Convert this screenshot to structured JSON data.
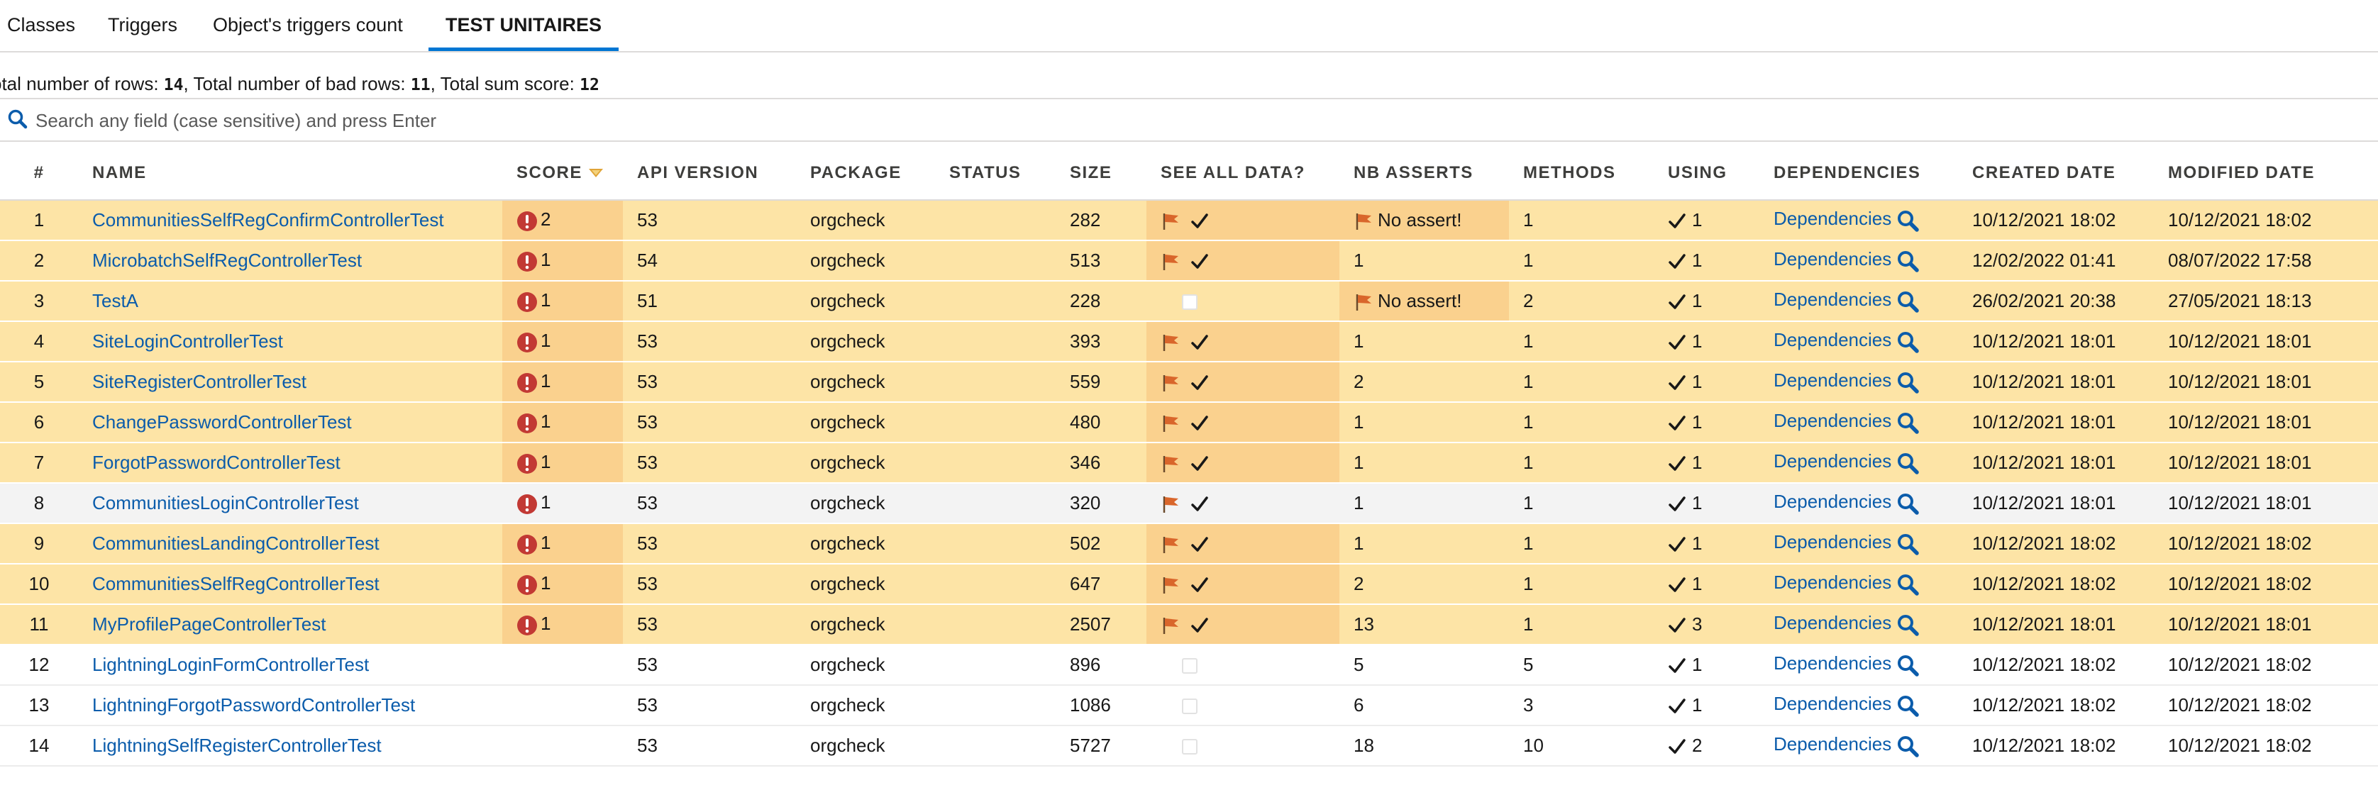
{
  "tabs": [
    {
      "label": "Classes",
      "active": false
    },
    {
      "label": "Triggers",
      "active": false
    },
    {
      "label": "Object's triggers count",
      "active": false
    },
    {
      "label": "TEST UNITAIRES",
      "active": true
    }
  ],
  "summary": {
    "total_rows_label": "otal number of rows:",
    "total_rows": "14",
    "bad_rows_label": "Total number of bad rows:",
    "bad_rows": "11",
    "sum_score_label": "Total sum score:",
    "sum_score": "12"
  },
  "search": {
    "placeholder": "Search any field (case sensitive) and press Enter",
    "value": ""
  },
  "table": {
    "headers": {
      "num": "#",
      "name": "NAME",
      "score": "SCORE",
      "api_version": "API VERSION",
      "package": "PACKAGE",
      "status": "STATUS",
      "size": "SIZE",
      "see_all_data": "SEE ALL DATA?",
      "nb_asserts": "NB ASSERTS",
      "methods": "METHODS",
      "using": "USING",
      "dependencies": "DEPENDENCIES",
      "created_date": "CREATED DATE",
      "modified_date": "MODIFIED DATE"
    },
    "dependencies_label": "Dependencies",
    "no_assert_label": "No assert!",
    "rows": [
      {
        "num": "1",
        "name": "CommunitiesSelfRegConfirmControllerTest",
        "score": "2",
        "api": "53",
        "package": "orgcheck",
        "status": "",
        "size": "282",
        "see_all_data": true,
        "nb_asserts": "",
        "no_assert": true,
        "methods": "1",
        "using": "1",
        "created": "10/12/2021 18:02",
        "modified": "10/12/2021 18:02",
        "style": "bad"
      },
      {
        "num": "2",
        "name": "MicrobatchSelfRegControllerTest",
        "score": "1",
        "api": "54",
        "package": "orgcheck",
        "status": "",
        "size": "513",
        "see_all_data": true,
        "nb_asserts": "1",
        "no_assert": false,
        "methods": "1",
        "using": "1",
        "created": "12/02/2022 01:41",
        "modified": "08/07/2022 17:58",
        "style": "bad"
      },
      {
        "num": "3",
        "name": "TestA",
        "score": "1",
        "api": "51",
        "package": "orgcheck",
        "status": "",
        "size": "228",
        "see_all_data": false,
        "nb_asserts": "",
        "no_assert": true,
        "methods": "2",
        "using": "1",
        "created": "26/02/2021 20:38",
        "modified": "27/05/2021 18:13",
        "style": "bad"
      },
      {
        "num": "4",
        "name": "SiteLoginControllerTest",
        "score": "1",
        "api": "53",
        "package": "orgcheck",
        "status": "",
        "size": "393",
        "see_all_data": true,
        "nb_asserts": "1",
        "no_assert": false,
        "methods": "1",
        "using": "1",
        "created": "10/12/2021 18:01",
        "modified": "10/12/2021 18:01",
        "style": "bad"
      },
      {
        "num": "5",
        "name": "SiteRegisterControllerTest",
        "score": "1",
        "api": "53",
        "package": "orgcheck",
        "status": "",
        "size": "559",
        "see_all_data": true,
        "nb_asserts": "2",
        "no_assert": false,
        "methods": "1",
        "using": "1",
        "created": "10/12/2021 18:01",
        "modified": "10/12/2021 18:01",
        "style": "bad"
      },
      {
        "num": "6",
        "name": "ChangePasswordControllerTest",
        "score": "1",
        "api": "53",
        "package": "orgcheck",
        "status": "",
        "size": "480",
        "see_all_data": true,
        "nb_asserts": "1",
        "no_assert": false,
        "methods": "1",
        "using": "1",
        "created": "10/12/2021 18:01",
        "modified": "10/12/2021 18:01",
        "style": "bad"
      },
      {
        "num": "7",
        "name": "ForgotPasswordControllerTest",
        "score": "1",
        "api": "53",
        "package": "orgcheck",
        "status": "",
        "size": "346",
        "see_all_data": true,
        "nb_asserts": "1",
        "no_assert": false,
        "methods": "1",
        "using": "1",
        "created": "10/12/2021 18:01",
        "modified": "10/12/2021 18:01",
        "style": "bad"
      },
      {
        "num": "8",
        "name": "CommunitiesLoginControllerTest",
        "score": "1",
        "api": "53",
        "package": "orgcheck",
        "status": "",
        "size": "320",
        "see_all_data": true,
        "nb_asserts": "1",
        "no_assert": false,
        "methods": "1",
        "using": "1",
        "created": "10/12/2021 18:01",
        "modified": "10/12/2021 18:01",
        "style": "hover"
      },
      {
        "num": "9",
        "name": "CommunitiesLandingControllerTest",
        "score": "1",
        "api": "53",
        "package": "orgcheck",
        "status": "",
        "size": "502",
        "see_all_data": true,
        "nb_asserts": "1",
        "no_assert": false,
        "methods": "1",
        "using": "1",
        "created": "10/12/2021 18:02",
        "modified": "10/12/2021 18:02",
        "style": "bad"
      },
      {
        "num": "10",
        "name": "CommunitiesSelfRegControllerTest",
        "score": "1",
        "api": "53",
        "package": "orgcheck",
        "status": "",
        "size": "647",
        "see_all_data": true,
        "nb_asserts": "2",
        "no_assert": false,
        "methods": "1",
        "using": "1",
        "created": "10/12/2021 18:02",
        "modified": "10/12/2021 18:02",
        "style": "bad"
      },
      {
        "num": "11",
        "name": "MyProfilePageControllerTest",
        "score": "1",
        "api": "53",
        "package": "orgcheck",
        "status": "",
        "size": "2507",
        "see_all_data": true,
        "nb_asserts": "13",
        "no_assert": false,
        "methods": "1",
        "using": "3",
        "created": "10/12/2021 18:01",
        "modified": "10/12/2021 18:01",
        "style": "bad"
      },
      {
        "num": "12",
        "name": "LightningLoginFormControllerTest",
        "score": "",
        "api": "53",
        "package": "orgcheck",
        "status": "",
        "size": "896",
        "see_all_data": false,
        "nb_asserts": "5",
        "no_assert": false,
        "methods": "5",
        "using": "1",
        "created": "10/12/2021 18:02",
        "modified": "10/12/2021 18:02",
        "style": "plain"
      },
      {
        "num": "13",
        "name": "LightningForgotPasswordControllerTest",
        "score": "",
        "api": "53",
        "package": "orgcheck",
        "status": "",
        "size": "1086",
        "see_all_data": false,
        "nb_asserts": "6",
        "no_assert": false,
        "methods": "3",
        "using": "1",
        "created": "10/12/2021 18:02",
        "modified": "10/12/2021 18:02",
        "style": "plain"
      },
      {
        "num": "14",
        "name": "LightningSelfRegisterControllerTest",
        "score": "",
        "api": "53",
        "package": "orgcheck",
        "status": "",
        "size": "5727",
        "see_all_data": false,
        "nb_asserts": "18",
        "no_assert": false,
        "methods": "10",
        "using": "2",
        "created": "10/12/2021 18:02",
        "modified": "10/12/2021 18:02",
        "style": "plain"
      }
    ]
  },
  "colors": {
    "accent": "#0176d3",
    "link": "#0b5cab",
    "bad_row": "#fde4a6",
    "bad_cell": "#fad18e",
    "error": "#c23934",
    "flag": "#d9662b"
  },
  "icons": [
    "search-icon",
    "sort-desc-icon",
    "error-icon",
    "flag-icon",
    "check-icon",
    "checkbox-icon",
    "magnifier-icon"
  ]
}
